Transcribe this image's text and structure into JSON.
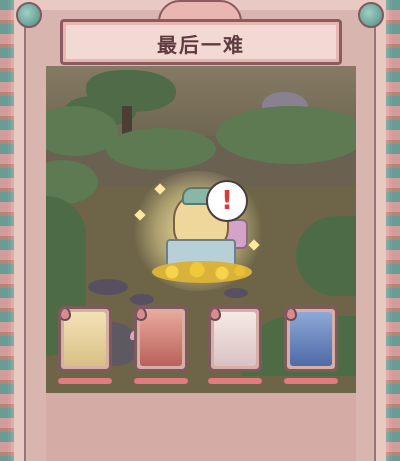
{
  "title": "最后一难",
  "alert": {
    "symbol": "!"
  },
  "colors": {
    "frame": "#e9c9c3",
    "banner_text": "#5f3b3f",
    "alert_mark": "#d93b3b",
    "hp_fill": "#e07c80"
  },
  "boss": {
    "name_icon": "golden-pig-on-treasure-chest"
  },
  "heroes": [
    {
      "icon": "monk-hero-portrait",
      "hp": 1.0
    },
    {
      "icon": "red-demon-hero-portrait",
      "hp": 1.0
    },
    {
      "icon": "white-horse-hero-portrait",
      "hp": 1.0
    },
    {
      "icon": "blue-demon-hero-portrait",
      "hp": 1.0
    }
  ]
}
